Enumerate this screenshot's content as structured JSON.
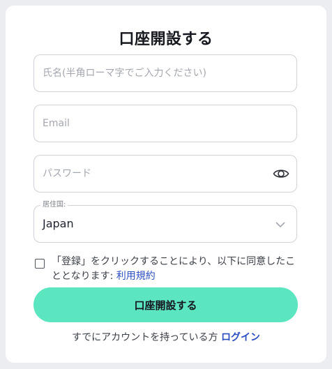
{
  "form": {
    "title": "口座開設する",
    "name_placeholder": "氏名(半角ローマ字でご入力ください)",
    "email_placeholder": "Email",
    "password_placeholder": "パスワード",
    "password_toggle_icon": "eye-icon",
    "country_label": "居住国:",
    "country_value": "Japan",
    "country_dropdown_icon": "chevron-down-icon",
    "consent_text": "「登録」をクリックすることにより、以下に同意したこととなります: ",
    "consent_link": "利用規約",
    "consent_checked": false,
    "submit_label": "口座開設する",
    "login_prompt": "すでにアカウントを持っている方 ",
    "login_link": "ログイン"
  },
  "colors": {
    "background": "#ecedf0",
    "card": "#ffffff",
    "accent": "#5ce6c0",
    "link": "#2b4ec0",
    "border": "#cfd2d8"
  }
}
